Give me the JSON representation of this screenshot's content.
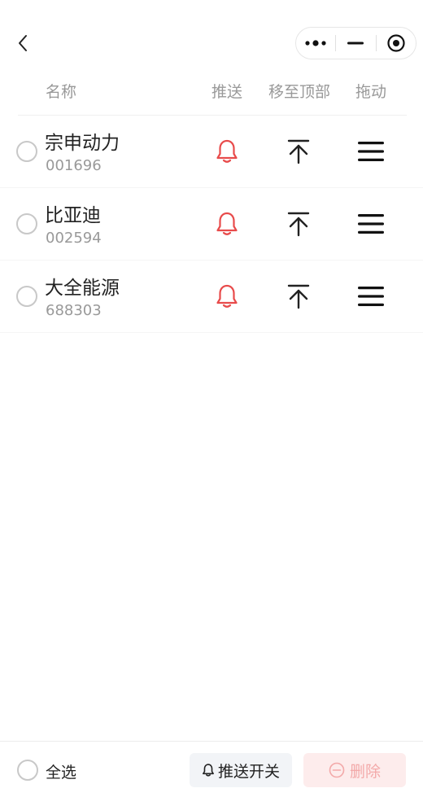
{
  "nav": {
    "back_icon": "chevron-left-icon",
    "capsule": [
      "more-dots-icon",
      "minimize-icon",
      "close-target-icon"
    ]
  },
  "header": {
    "name": "名称",
    "push": "推送",
    "move_top": "移至顶部",
    "drag": "拖动"
  },
  "stocks": [
    {
      "name": "宗申动力",
      "code": "001696"
    },
    {
      "name": "比亚迪",
      "code": "002594"
    },
    {
      "name": "大全能源",
      "code": "688303"
    }
  ],
  "footer": {
    "select_all": "全选",
    "push_toggle": "推送开关",
    "delete": "删除"
  },
  "colors": {
    "bell": "#e84b4b",
    "icon_dark": "#222222",
    "delete_text": "#f3a9a9",
    "delete_bg": "#fdecec"
  }
}
